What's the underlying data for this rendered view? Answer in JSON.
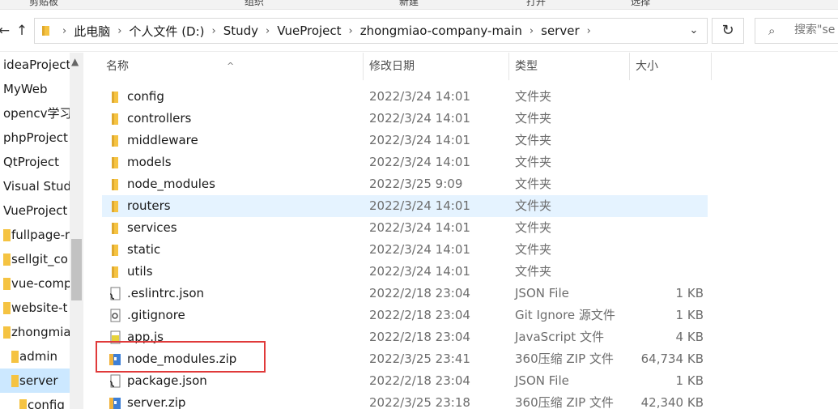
{
  "ribbon": {
    "labels": [
      "剪贴板",
      "组织",
      "新建",
      "打开",
      "选择"
    ]
  },
  "nav": {
    "back_glyph": "←",
    "up_glyph": "↑",
    "breadcrumbs": [
      "此电脑",
      "个人文件 (D:)",
      "Study",
      "VueProject",
      "zhongmiao-company-main",
      "server"
    ],
    "separator": "›",
    "dropdown_glyph": "⌄",
    "refresh_glyph": "↻"
  },
  "search": {
    "icon": "⌕",
    "placeholder": "搜索\"se"
  },
  "tree": {
    "items": [
      {
        "label": "ideaProject",
        "indent": 0,
        "selected": false
      },
      {
        "label": "MyWeb",
        "indent": 0,
        "selected": false
      },
      {
        "label": "opencv学习",
        "indent": 0,
        "selected": false
      },
      {
        "label": "phpProject",
        "indent": 0,
        "selected": false
      },
      {
        "label": "QtProject",
        "indent": 0,
        "selected": false
      },
      {
        "label": "Visual Studio",
        "indent": 0,
        "selected": false
      },
      {
        "label": "VueProject",
        "indent": 0,
        "selected": false
      },
      {
        "label": "fullpage-r",
        "indent": 1,
        "selected": false
      },
      {
        "label": "sellgit_co",
        "indent": 1,
        "selected": false
      },
      {
        "label": "vue-comp",
        "indent": 1,
        "selected": false
      },
      {
        "label": "website-t",
        "indent": 1,
        "selected": false
      },
      {
        "label": "zhongmia",
        "indent": 1,
        "selected": false
      },
      {
        "label": "admin",
        "indent": 2,
        "selected": false
      },
      {
        "label": "server",
        "indent": 2,
        "selected": true
      },
      {
        "label": "config",
        "indent": 3,
        "selected": false
      }
    ]
  },
  "columns": {
    "name": "名称",
    "date": "修改日期",
    "type": "类型",
    "size": "大小",
    "sort_glyph": "^"
  },
  "files": [
    {
      "name": "config",
      "date": "2022/3/24 14:01",
      "type": "文件夹",
      "size": "",
      "icon": "folder"
    },
    {
      "name": "controllers",
      "date": "2022/3/24 14:01",
      "type": "文件夹",
      "size": "",
      "icon": "folder"
    },
    {
      "name": "middleware",
      "date": "2022/3/24 14:01",
      "type": "文件夹",
      "size": "",
      "icon": "folder"
    },
    {
      "name": "models",
      "date": "2022/3/24 14:01",
      "type": "文件夹",
      "size": "",
      "icon": "folder"
    },
    {
      "name": "node_modules",
      "date": "2022/3/25 9:09",
      "type": "文件夹",
      "size": "",
      "icon": "folder"
    },
    {
      "name": "routers",
      "date": "2022/3/24 14:01",
      "type": "文件夹",
      "size": "",
      "icon": "folder",
      "hover": true
    },
    {
      "name": "services",
      "date": "2022/3/24 14:01",
      "type": "文件夹",
      "size": "",
      "icon": "folder"
    },
    {
      "name": "static",
      "date": "2022/3/24 14:01",
      "type": "文件夹",
      "size": "",
      "icon": "folder"
    },
    {
      "name": "utils",
      "date": "2022/3/24 14:01",
      "type": "文件夹",
      "size": "",
      "icon": "folder"
    },
    {
      "name": ".eslintrc.json",
      "date": "2022/2/18 23:04",
      "type": "JSON File",
      "size": "1 KB",
      "icon": "json"
    },
    {
      "name": ".gitignore",
      "date": "2022/2/18 23:04",
      "type": "Git Ignore 源文件",
      "size": "1 KB",
      "icon": "gear"
    },
    {
      "name": "app.js",
      "date": "2022/2/18 23:04",
      "type": "JavaScript 文件",
      "size": "4 KB",
      "icon": "js"
    },
    {
      "name": "node_modules.zip",
      "date": "2022/3/25 23:41",
      "type": "360压缩 ZIP 文件",
      "size": "64,734 KB",
      "icon": "zip"
    },
    {
      "name": "package.json",
      "date": "2022/2/18 23:04",
      "type": "JSON File",
      "size": "1 KB",
      "icon": "json"
    },
    {
      "name": "server.zip",
      "date": "2022/3/25 23:18",
      "type": "360压缩 ZIP 文件",
      "size": "42,340 KB",
      "icon": "zip"
    }
  ],
  "colors": {
    "folder": "#f5c342",
    "selected": "#cce8ff",
    "hover": "#e5f3ff",
    "highlight_border": "#e03a3a"
  }
}
